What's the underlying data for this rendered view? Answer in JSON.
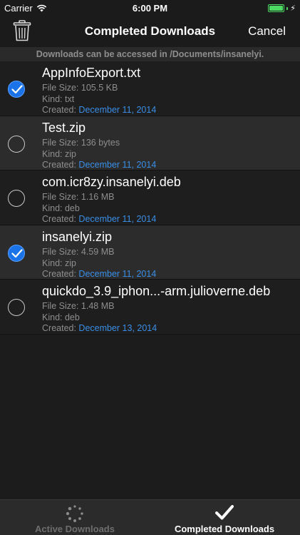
{
  "status": {
    "carrier": "Carrier",
    "time": "6:00 PM",
    "battery_level": 1.0
  },
  "nav": {
    "title": "Completed Downloads",
    "cancel_label": "Cancel",
    "trash_icon": "trash-icon"
  },
  "info": "Downloads can be accessed in /Documents/insanelyi.",
  "labels": {
    "size": "File Size: ",
    "kind": "Kind: ",
    "created": "Created: "
  },
  "files": [
    {
      "name": "AppInfoExport.txt",
      "size": "105.5 KB",
      "kind": "txt",
      "created": "December 11, 2014",
      "selected": true
    },
    {
      "name": "Test.zip",
      "size": "136 bytes",
      "kind": "zip",
      "created": "December 11, 2014",
      "selected": false
    },
    {
      "name": "com.icr8zy.insanelyi.deb",
      "size": "1.16 MB",
      "kind": "deb",
      "created": "December 11, 2014",
      "selected": false
    },
    {
      "name": "insanelyi.zip",
      "size": "4.59 MB",
      "kind": "zip",
      "created": "December 11, 2014",
      "selected": true
    },
    {
      "name": "quickdo_3.9_iphon...-arm.julioverne.deb",
      "size": "1.48 MB",
      "kind": "deb",
      "created": "December 13, 2014",
      "selected": false
    }
  ],
  "tabs": [
    {
      "label": "Active Downloads",
      "icon": "spinner-icon",
      "active": false
    },
    {
      "label": "Completed Downloads",
      "icon": "checkmark-icon",
      "active": true
    }
  ],
  "colors": {
    "accent": "#1a73e8",
    "date": "#3a8ee6",
    "battery": "#4cd964"
  }
}
